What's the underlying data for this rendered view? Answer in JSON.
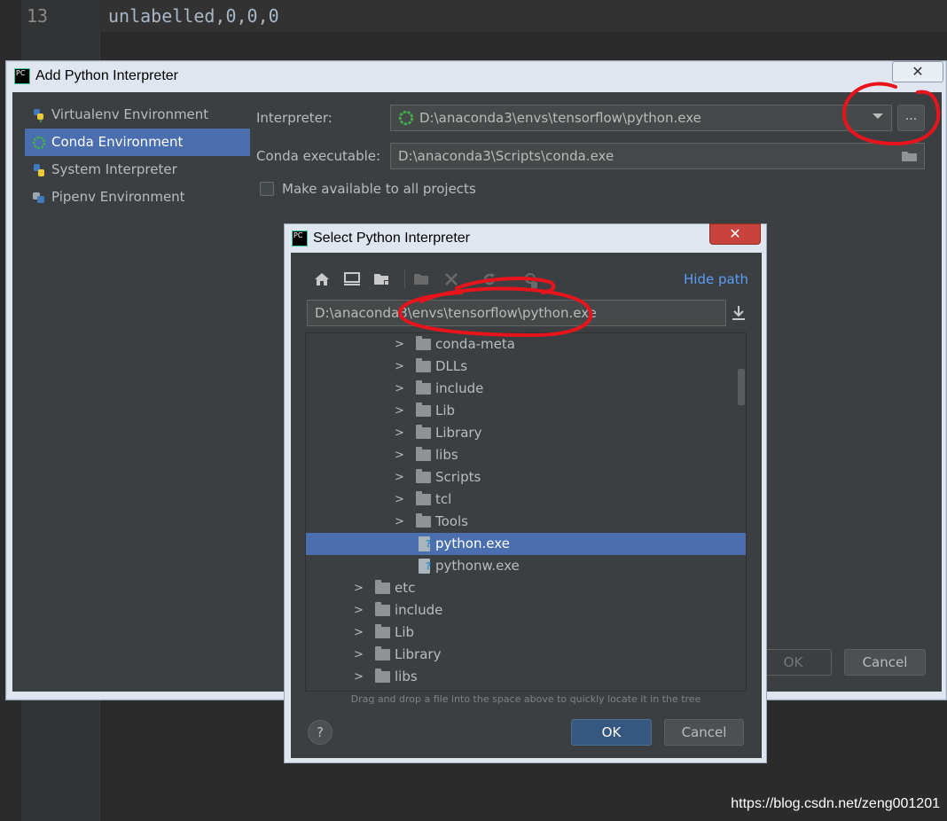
{
  "editor": {
    "line_number": "13",
    "code_line": "unlabelled,0,0,0"
  },
  "watermark": "https://blog.csdn.net/zeng001201",
  "outer_dialog": {
    "logo_text": "PC",
    "title": "Add Python Interpreter",
    "close_label": "✕",
    "sidebar": [
      {
        "label": "Virtualenv Environment",
        "icon": "python-virtualenv-icon",
        "selected": false
      },
      {
        "label": "Conda Environment",
        "icon": "conda-icon",
        "selected": true
      },
      {
        "label": "System Interpreter",
        "icon": "python-icon",
        "selected": false
      },
      {
        "label": "Pipenv Environment",
        "icon": "pipenv-icon",
        "selected": false
      }
    ],
    "interpreter_label": "Interpreter:",
    "interpreter_value": "D:\\anaconda3\\envs\\tensorflow\\python.exe",
    "browse_label": "...",
    "conda_label": "Conda executable:",
    "conda_value": "D:\\anaconda3\\Scripts\\conda.exe",
    "make_available_label": "Make available to all projects",
    "make_available_checked": false,
    "ok_label": "OK",
    "cancel_label": "Cancel"
  },
  "inner_dialog": {
    "logo_text": "PC",
    "title": "Select Python Interpreter",
    "close_label": "✕",
    "toolbar": [
      {
        "icon": "home-icon",
        "enabled": true
      },
      {
        "icon": "desktop-icon",
        "enabled": true
      },
      {
        "icon": "project-folder-icon",
        "enabled": true
      },
      {
        "icon": "new-folder-icon",
        "enabled": false
      },
      {
        "icon": "delete-icon",
        "enabled": false
      },
      {
        "icon": "refresh-icon",
        "enabled": false
      },
      {
        "icon": "show-hidden-icon",
        "enabled": false
      }
    ],
    "hide_path_label": "Hide path",
    "path_value": "D:\\anaconda3\\envs\\tensorflow\\python.exe",
    "tree": [
      {
        "label": "conda-meta",
        "type": "folder",
        "level": 2,
        "selected": false
      },
      {
        "label": "DLLs",
        "type": "folder",
        "level": 2,
        "selected": false
      },
      {
        "label": "include",
        "type": "folder",
        "level": 2,
        "selected": false
      },
      {
        "label": "Lib",
        "type": "folder",
        "level": 2,
        "selected": false
      },
      {
        "label": "Library",
        "type": "folder",
        "level": 2,
        "selected": false
      },
      {
        "label": "libs",
        "type": "folder",
        "level": 2,
        "selected": false
      },
      {
        "label": "Scripts",
        "type": "folder",
        "level": 2,
        "selected": false
      },
      {
        "label": "tcl",
        "type": "folder",
        "level": 2,
        "selected": false
      },
      {
        "label": "Tools",
        "type": "folder",
        "level": 2,
        "selected": false
      },
      {
        "label": "python.exe",
        "type": "file",
        "level": 2,
        "selected": true
      },
      {
        "label": "pythonw.exe",
        "type": "file",
        "level": 2,
        "selected": false
      },
      {
        "label": "etc",
        "type": "folder",
        "level": 1,
        "selected": false
      },
      {
        "label": "include",
        "type": "folder",
        "level": 1,
        "selected": false
      },
      {
        "label": "Lib",
        "type": "folder",
        "level": 1,
        "selected": false
      },
      {
        "label": "Library",
        "type": "folder",
        "level": 1,
        "selected": false
      },
      {
        "label": "libs",
        "type": "folder",
        "level": 1,
        "selected": false
      }
    ],
    "hint": "Drag and drop a file into the space above to quickly locate it in the tree",
    "help_label": "?",
    "ok_label": "OK",
    "cancel_label": "Cancel"
  },
  "colors": {
    "selection": "#4b6eaf",
    "annotation": "#e8141c",
    "link": "#589df6"
  }
}
